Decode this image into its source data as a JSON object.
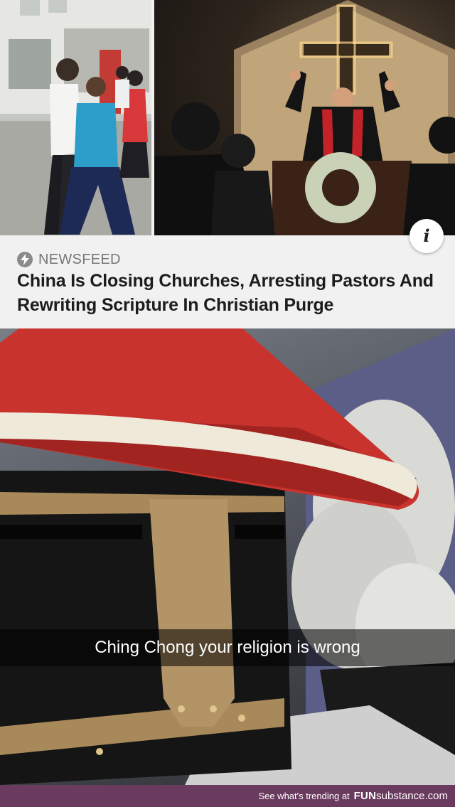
{
  "article": {
    "source": "NEWSFEED",
    "headline": "China Is Closing Churches, Arresting Pastors And Rewriting Scripture In Christian Purge",
    "info_icon_glyph": "i"
  },
  "meme": {
    "caption": "Ching Chong your religion is wrong"
  },
  "footer": {
    "text": "See what's trending at",
    "brand_bold": "FUN",
    "brand_rest": "substance.com"
  },
  "colors": {
    "footer_bg": "#6a3a5f",
    "hat_red": "#c8332e",
    "helmet_brass": "#a8895a"
  },
  "icons": [
    "info-icon",
    "bolt-icon"
  ]
}
